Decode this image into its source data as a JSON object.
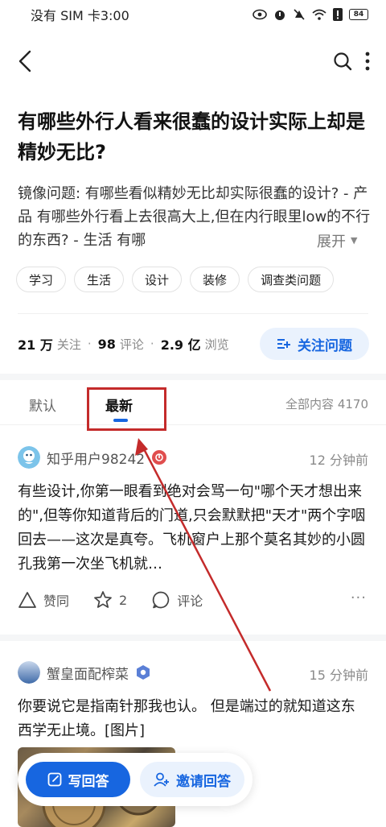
{
  "status_bar": {
    "carrier_time": "没有 SIM 卡3:00",
    "battery": "84"
  },
  "nav": {
    "back_icon": "back-chevron",
    "search_icon": "search-icon",
    "more_icon": "more-vertical-icon"
  },
  "question": {
    "title": "有哪些外行人看来很蠢的设计实际上却是精妙无比?",
    "description": "镜像问题: 有哪些看似精妙无比却实际很蠢的设计? - 产品 有哪些外行看上去很高大上,但在内行眼里low的不行的东西? - 生活 有哪",
    "expand_label": "展开",
    "tags": [
      "学习",
      "生活",
      "设计",
      "装修",
      "调查类问题"
    ],
    "followers_value": "21 万",
    "followers_label": "关注",
    "comments_value": "98",
    "comments_label": "评论",
    "views_value": "2.9 亿",
    "views_label": "浏览",
    "follow_button": "关注问题"
  },
  "tabs": {
    "default": "默认",
    "latest": "最新",
    "all_content": "全部内容 4170"
  },
  "answers": [
    {
      "author": "知乎用户98242",
      "time": "12 分钟前",
      "text": "有些设计,你第一眼看到绝对会骂一句\"哪个天才想出来的\",但等你知道背后的门道,只会默默把\"天才\"两个字咽回去——这次是真夸。飞机窗户上那个莫名其妙的小圆孔我第一次坐飞机就…",
      "upvote_label": "赞同",
      "favorite_count": "2",
      "comment_label": "评论"
    },
    {
      "author": "蟹皇面配榨菜",
      "time": "15 分钟前",
      "text": "你要说它是指南针那我也认。 但是端过的就知道这东西学无止境。[图片]"
    }
  ],
  "bottom": {
    "write_answer": "写回答",
    "invite_answer": "邀请回答"
  },
  "colors": {
    "accent": "#1766e0",
    "annotation_red": "#c42b2b"
  }
}
